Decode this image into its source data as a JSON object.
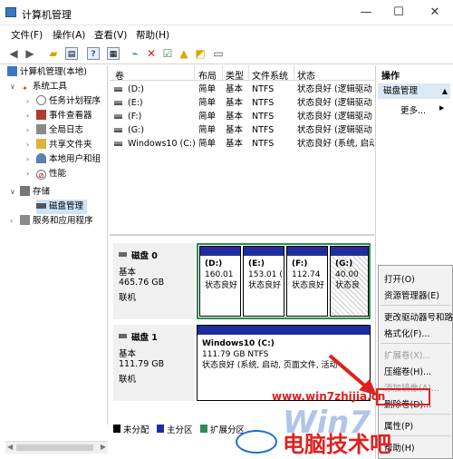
{
  "window": {
    "title": "计算机管理",
    "controls": {
      "minimize": "—",
      "maximize": "☐",
      "close": "✕"
    }
  },
  "menu": [
    "文件(F)",
    "操作(A)",
    "查看(V)",
    "帮助(H)"
  ],
  "toolbar_icons": [
    "back-arrow-icon",
    "forward-arrow-icon",
    "up-folder-icon",
    "show-hide-tree-icon",
    "help-icon",
    "properties-icon",
    "connect-icon",
    "delete-icon",
    "check-icon",
    "import-icon",
    "export-icon",
    "view-icon"
  ],
  "tree": {
    "root": "计算机管理(本地)",
    "system_tools": "系统工具",
    "task_scheduler": "任务计划程序",
    "event_viewer": "事件查看器",
    "shared_folders": "全局日志",
    "shared": "共享文件夹",
    "local_users": "本地用户和组",
    "performance": "性能",
    "storage": "存储",
    "disk_management": "磁盘管理",
    "services": "服务和应用程序"
  },
  "volume_table": {
    "headers": [
      "卷",
      "布局",
      "类型",
      "文件系统",
      "状态"
    ],
    "rows": [
      [
        "(D:)",
        "简单",
        "基本",
        "NTFS",
        "状态良好 (逻辑驱动"
      ],
      [
        "(E:)",
        "简单",
        "基本",
        "NTFS",
        "状态良好 (逻辑驱动"
      ],
      [
        "(F:)",
        "简单",
        "基本",
        "NTFS",
        "状态良好 (逻辑驱动"
      ],
      [
        "(G:)",
        "简单",
        "基本",
        "NTFS",
        "状态良好 (逻辑驱动"
      ],
      [
        "Windows10 (C:)",
        "简单",
        "基本",
        "NTFS",
        "状态良好 (系统, 启动"
      ]
    ]
  },
  "disks": [
    {
      "name": "磁盘 0",
      "type": "基本",
      "size": "465.76 GB",
      "status": "联机",
      "partitions": [
        {
          "name": "(D:)",
          "size": "160.01",
          "status": "状态良好"
        },
        {
          "name": "(E:)",
          "size": "153.01 (",
          "status": "状态良好"
        },
        {
          "name": "(F:)",
          "size": "112.74",
          "status": "状态良好"
        },
        {
          "name": "(G:)",
          "size": "40.00",
          "status": "状态良"
        }
      ]
    },
    {
      "name": "磁盘 1",
      "type": "基本",
      "size": "111.79 GB",
      "status": "联机",
      "partitions": [
        {
          "name": "Windows10  (C:)",
          "size": "111.79 GB NTFS",
          "status": "状态良好 (系统, 启动, 页面文件, 活动"
        }
      ]
    }
  ],
  "legend": [
    "未分配",
    "主分区",
    "扩展分区"
  ],
  "legend_colors": [
    "#000000",
    "#1f2d9c",
    "#2e8b57"
  ],
  "actions_pane": {
    "title": "操作",
    "selected": "磁盘管理",
    "more": "更多..."
  },
  "context_menu": {
    "items": [
      "打开(O)",
      "资源管理器(E)",
      "更改驱动器号和路",
      "格式化(F)...",
      "扩展卷(X)...",
      "压缩卷(H)...",
      "添加镜像(A)...",
      "删除卷(D)...",
      "属性(P)",
      "帮助(H)"
    ],
    "disabled": [
      false,
      false,
      false,
      false,
      true,
      false,
      true,
      false,
      false,
      false
    ]
  },
  "watermark": {
    "url": "www.win7zhijia.cn",
    "brand": "电脑技术吧",
    "logo": "Win7"
  }
}
